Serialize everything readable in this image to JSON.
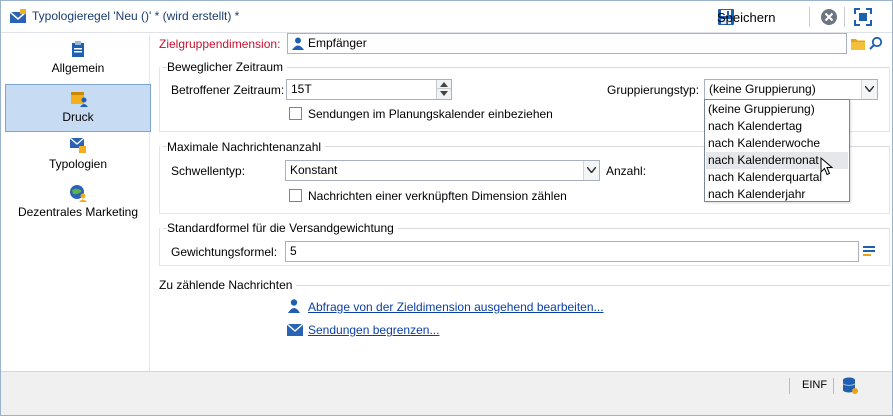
{
  "window": {
    "title": "Typologieregel 'Neu ()' * (wird erstellt) *",
    "save_label": "Speichern"
  },
  "icons": {
    "title": "envelope-rule-icon",
    "save": "floppy-disk-icon",
    "close": "close-circle-icon",
    "maximize": "maximize-icon",
    "folder": "folder-icon",
    "search": "search-icon",
    "person": "person-icon",
    "envelope": "envelope-icon",
    "formula": "formula-editor-icon",
    "database": "database-icon"
  },
  "colors": {
    "accent": "#1a5fb4",
    "active_tab": "#c7dcf2",
    "required_label": "#c8102e",
    "link": "#0b3fa6"
  },
  "sidebar": {
    "items": [
      {
        "label": "Allgemein",
        "icon": "clipboard-icon",
        "active": false
      },
      {
        "label": "Druck",
        "icon": "calendar-person-icon",
        "active": true
      },
      {
        "label": "Typologien",
        "icon": "typology-icon",
        "active": false
      },
      {
        "label": "Dezentrales Marketing",
        "icon": "globe-person-icon",
        "active": false
      }
    ]
  },
  "target": {
    "label": "Zielgruppendimension:",
    "value": "Empfänger"
  },
  "period": {
    "title": "Beweglicher Zeitraum",
    "period_label": "Betroffener Zeitraum:",
    "period_value": "15T",
    "grouping_label": "Gruppierungstyp:",
    "grouping_value": "(keine Gruppierung)",
    "calendar_checkbox": "Sendungen im Planungskalender einbeziehen",
    "calendar_checked": false
  },
  "grouping_options": [
    "(keine Gruppierung)",
    "nach Kalendertag",
    "nach Kalenderwoche",
    "nach Kalendermonat",
    "nach Kalenderquartal",
    "nach Kalenderjahr"
  ],
  "grouping_hover_index": 3,
  "max_messages": {
    "title": "Maximale Nachrichtenanzahl",
    "threshold_label": "Schwellentyp:",
    "threshold_value": "Konstant",
    "count_label": "Anzahl:",
    "linked_checkbox": "Nachrichten einer verknüpften Dimension zählen",
    "linked_checked": false
  },
  "weighting": {
    "title": "Standardformel für die Versandgewichtung",
    "formula_label": "Gewichtungsformel:",
    "formula_value": "5"
  },
  "count_messages": {
    "title": "Zu zählende Nachrichten",
    "link_query": "Abfrage von der Zieldimension ausgehend bearbeiten...",
    "link_limit": "Sendungen begrenzen..."
  },
  "status": {
    "mode": "EINF"
  }
}
